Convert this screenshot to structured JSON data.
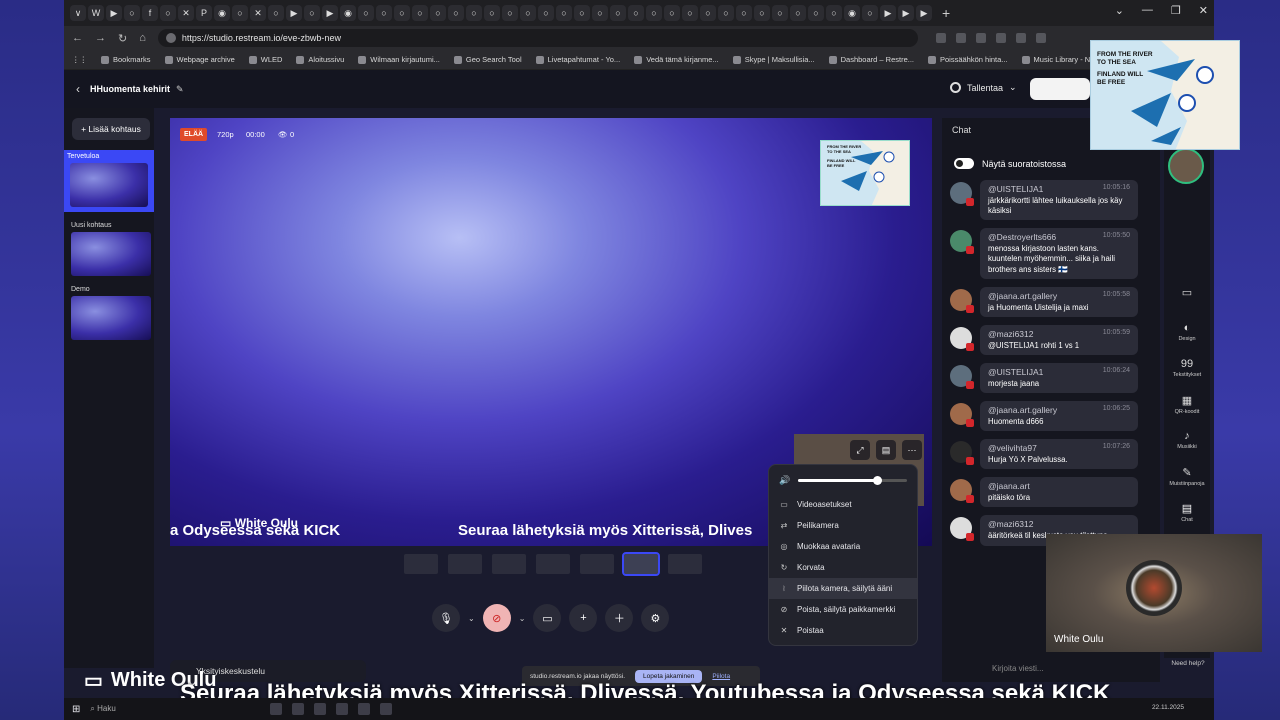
{
  "browser": {
    "url": "https://studio.restream.io/eve-zbwb-new",
    "bookmarks": [
      "Bookmarks",
      "Webpage archive",
      "WLED",
      "Aloitussivu",
      "Wilmaan kirjautumi...",
      "Geo Search Tool",
      "Livetapahtumat - Yo...",
      "Vedä tämä kirjanme...",
      "Skype | Maksullisia...",
      "Dashboard – Restre...",
      "Poissäähkön hinta...",
      "Music Library - NCS"
    ],
    "tab_icons": [
      "∨",
      "W",
      "▶",
      "○",
      "f",
      "○",
      "✕",
      "P",
      "◉",
      "○",
      "✕",
      "○",
      "▶",
      "○",
      "▶",
      "◉",
      "○",
      "○",
      "○",
      "○",
      "○",
      "○",
      "○",
      "○",
      "○",
      "○",
      "○",
      "○",
      "○",
      "○",
      "○",
      "○",
      "○",
      "○",
      "○",
      "○",
      "○",
      "○",
      "○",
      "○",
      "○",
      "○",
      "○",
      "◉",
      "○",
      "▶",
      "▶",
      "▶"
    ],
    "win_controls": [
      "⌄",
      "—",
      "❐",
      "✕"
    ]
  },
  "studio": {
    "title": "HHuomenta kehirit",
    "record_label": "Tallentaa",
    "add_scene": "+ Lisää kohtaus",
    "scenes": [
      {
        "label": "Tervetuloa",
        "active": true
      },
      {
        "label": "Uusi kohtaus",
        "active": false
      },
      {
        "label": "Demo",
        "active": false
      }
    ]
  },
  "canvas": {
    "live_badge": "ELÄÄ",
    "resolution": "720p",
    "timer": "00:00",
    "viewers": "0",
    "name_tag": "White Oulu",
    "ticker_left": "a Odyseessa sekä KICK",
    "ticker_right": "Seuraa lähetyksiä myös Xitterissä, Dlives",
    "map_text": [
      "FROM THE RIVER",
      "TO THE SEA",
      "FINLAND WILL",
      "BE FREE"
    ]
  },
  "menu": {
    "volume_fraction": 0.72,
    "items": [
      {
        "icon": "video-settings-icon",
        "glyph": "▭",
        "label": "Videoasetukset"
      },
      {
        "icon": "mirror-icon",
        "glyph": "⇄",
        "label": "Peilikamera"
      },
      {
        "icon": "avatar-icon",
        "glyph": "◎",
        "label": "Muokkaa avataria"
      },
      {
        "icon": "replace-icon",
        "glyph": "↻",
        "label": "Korvata"
      },
      {
        "icon": "hide-camera-icon",
        "glyph": "⧘",
        "label": "Piilota kamera, säilytä ääni"
      },
      {
        "icon": "hide-placeholder-icon",
        "glyph": "⊘",
        "label": "Poista, säilytä paikkamerkki"
      },
      {
        "icon": "remove-icon",
        "glyph": "✕",
        "label": "Poistaa"
      }
    ]
  },
  "chat": {
    "title": "Chat",
    "toggle_label": "Näytä suoratoistossa",
    "input_placeholder": "Kirjoita viesti...",
    "messages": [
      {
        "user": "@UISTELIJA1",
        "time": "10:05:16",
        "text": "järkkärikortti lähtee luikauksella jos käy käsiksi",
        "avatar_color": "#5d6e7d"
      },
      {
        "user": "@Destroyerlts666",
        "time": "10:05:50",
        "text": "menossa kirjastoon lasten kans. kuuntelen myöhemmin... siika ja haili brothers ans sisters 🇫🇮",
        "avatar_color": "#4a8a6a"
      },
      {
        "user": "@jaana.art.gallery",
        "time": "10:05:58",
        "text": "ja Huomenta Uistelija ja maxi",
        "avatar_color": "#a06a4a"
      },
      {
        "user": "@mazi6312",
        "time": "10:05:59",
        "text": "@UISTELIJA1 rohti 1 vs 1",
        "avatar_color": "#dddddd"
      },
      {
        "user": "@UISTELIJA1",
        "time": "10:06:24",
        "text": "morjesta jaana",
        "avatar_color": "#5d6e7d"
      },
      {
        "user": "@jaana.art.gallery",
        "time": "10:06:25",
        "text": "Huomenta d666",
        "avatar_color": "#a06a4a"
      },
      {
        "user": "@velivihta97",
        "time": "10:07:26",
        "text": "Hurja Yö X Palvelussa.",
        "avatar_color": "#2a2a2a"
      },
      {
        "user": "@jaana.art",
        "time": "",
        "text": "pitäisko töra",
        "avatar_color": "#a06a4a"
      },
      {
        "user": "@mazi6312",
        "time": "",
        "text": "ääritörkeä til keskusta you tilattuna",
        "avatar_color": "#dddddd"
      }
    ]
  },
  "rail": [
    {
      "icon": "folder-icon",
      "glyph": "▭",
      "label": ""
    },
    {
      "icon": "design-icon",
      "glyph": "◐",
      "label": "Design"
    },
    {
      "icon": "quote-icon",
      "glyph": "99",
      "label": "Tekstitykset"
    },
    {
      "icon": "qr-icon",
      "glyph": "▦",
      "label": "QR-koodit"
    },
    {
      "icon": "music-icon",
      "glyph": "♪",
      "label": "Musiikki"
    },
    {
      "icon": "notes-icon",
      "glyph": "✎",
      "label": "Muistiinpanoja"
    },
    {
      "icon": "chat-icon",
      "glyph": "▤",
      "label": "Chat"
    }
  ],
  "need_help": "Need help?",
  "private_chat": "Yksityiskeskustelu",
  "share": {
    "text": "studio.restream.io jakaa näyttösi.",
    "stop": "Lopeta jakaminen",
    "hide": "Piilota"
  },
  "overlay": {
    "cam_name": "White Oulu",
    "big_name": "White Oulu",
    "big_ticker": "Seuraa lähetyksiä myös Xitterissä, Dlivessä, Youtubessa ja Odyseessa sekä KICK"
  },
  "taskbar": {
    "search": "Haku",
    "date": "22.11.2025"
  }
}
